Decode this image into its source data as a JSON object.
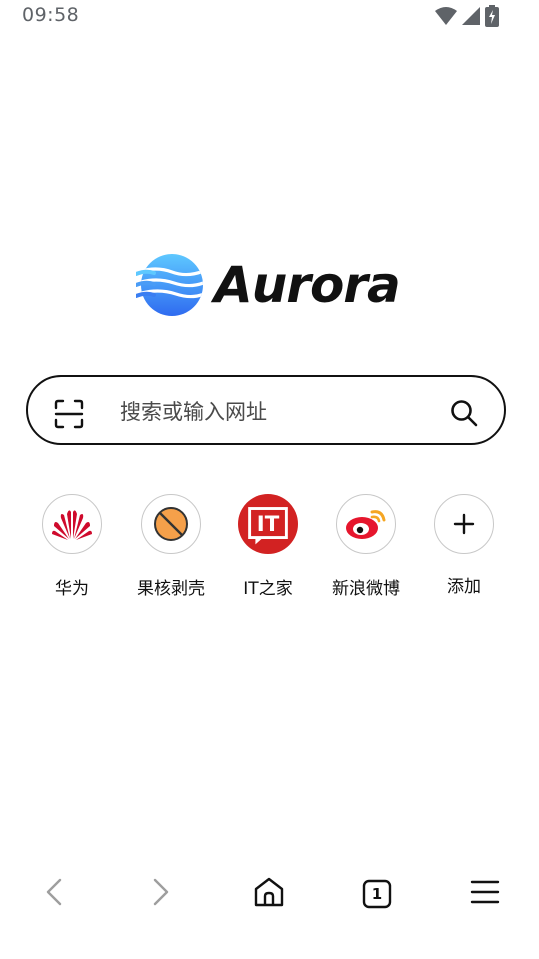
{
  "status_bar": {
    "time": "09:58",
    "icons": [
      "wifi-icon",
      "signal-icon",
      "battery-charging-icon"
    ]
  },
  "brand": {
    "name": "Aurora",
    "logo_colors": [
      "#5ec8ff",
      "#2f6bf0"
    ]
  },
  "search": {
    "placeholder": "搜索或输入网址",
    "value": "",
    "scan_icon": "scan-icon",
    "search_icon": "search-icon"
  },
  "shortcuts": [
    {
      "label": "华为",
      "icon": "huawei-icon",
      "color": "#cf0a2c"
    },
    {
      "label": "果核剥壳",
      "icon": "guohe-icon",
      "color": "#f5a04a"
    },
    {
      "label": "IT之家",
      "icon": "ithome-icon",
      "color": "#d22222"
    },
    {
      "label": "新浪微博",
      "icon": "weibo-icon",
      "color": "#e6162d"
    },
    {
      "label": "添加",
      "icon": "plus-icon",
      "color": "#111111"
    }
  ],
  "bottom_nav": {
    "back_icon": "chevron-left-icon",
    "forward_icon": "chevron-right-icon",
    "home_icon": "home-icon",
    "tabs_count": "1",
    "menu_icon": "menu-icon"
  }
}
